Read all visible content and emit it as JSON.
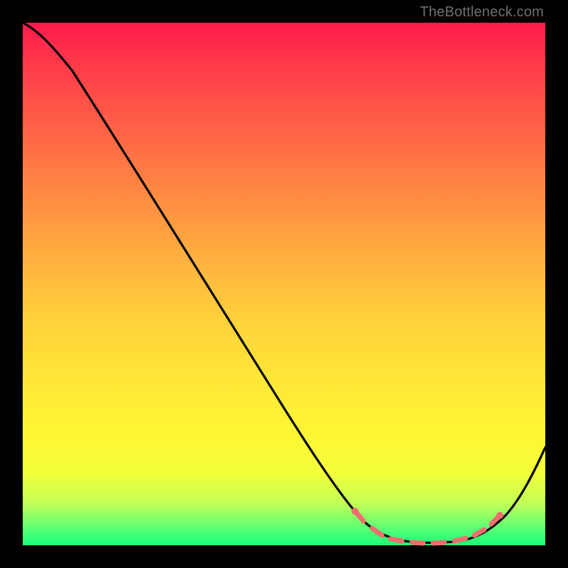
{
  "watermark": "TheBottleneck.com",
  "colors": {
    "frame": "#000000",
    "curve": "#000000",
    "accent": "#ef6e6e",
    "gradient_top": "#ff1a4d",
    "gradient_bottom": "#18ff77"
  },
  "chart_data": {
    "type": "line",
    "title": "",
    "xlabel": "",
    "ylabel": "",
    "xlim": [
      0,
      100
    ],
    "ylim": [
      0,
      100
    ],
    "x": [
      0,
      2,
      5,
      10,
      15,
      20,
      25,
      30,
      35,
      40,
      45,
      50,
      55,
      60,
      63,
      67,
      70,
      73,
      76,
      79,
      82,
      85,
      88,
      91,
      94,
      97,
      100
    ],
    "y": [
      100,
      99,
      97,
      91,
      83,
      75,
      67,
      59,
      51,
      43,
      35,
      27,
      19,
      11,
      6,
      3,
      1.5,
      0.8,
      0.5,
      0.5,
      0.6,
      1,
      2,
      5,
      10,
      17,
      25
    ],
    "highlighted_segment": {
      "x": [
        63,
        67,
        70,
        73,
        76,
        79,
        82,
        85,
        88,
        91
      ],
      "y": [
        6,
        3,
        1.5,
        0.8,
        0.5,
        0.5,
        0.6,
        1,
        2,
        5
      ]
    }
  }
}
